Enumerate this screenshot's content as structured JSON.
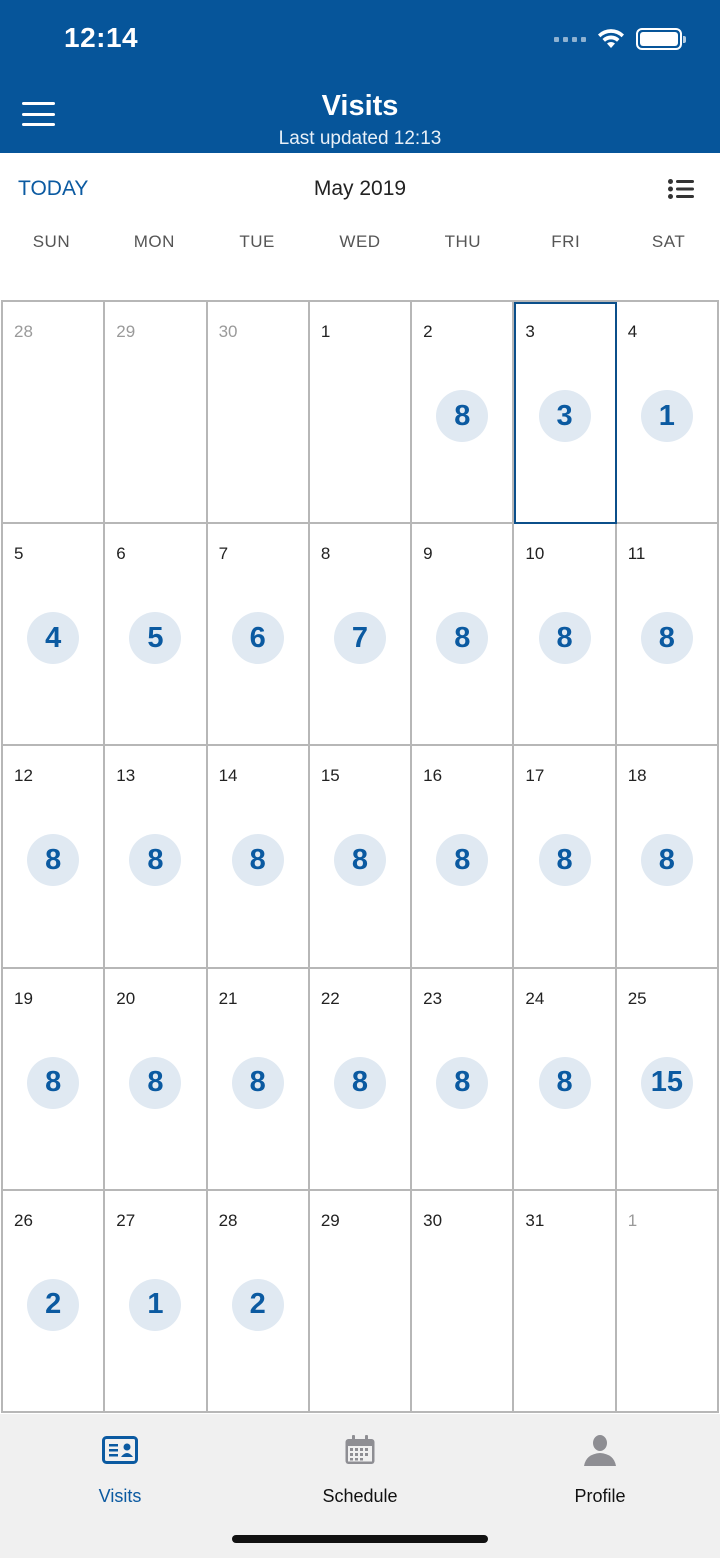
{
  "status_bar": {
    "time": "12:14"
  },
  "header": {
    "title": "Visits",
    "subtitle": "Last updated 12:13"
  },
  "toolbar": {
    "today_label": "TODAY",
    "month": "May 2019"
  },
  "weekdays": [
    "SUN",
    "MON",
    "TUE",
    "WED",
    "THU",
    "FRI",
    "SAT"
  ],
  "calendar": {
    "selected_day": "3",
    "weeks": [
      [
        {
          "day": "28",
          "muted": true,
          "count": ""
        },
        {
          "day": "29",
          "muted": true,
          "count": ""
        },
        {
          "day": "30",
          "muted": true,
          "count": ""
        },
        {
          "day": "1",
          "muted": false,
          "count": ""
        },
        {
          "day": "2",
          "muted": false,
          "count": "8"
        },
        {
          "day": "3",
          "muted": false,
          "count": "3"
        },
        {
          "day": "4",
          "muted": false,
          "count": "1"
        }
      ],
      [
        {
          "day": "5",
          "muted": false,
          "count": "4"
        },
        {
          "day": "6",
          "muted": false,
          "count": "5"
        },
        {
          "day": "7",
          "muted": false,
          "count": "6"
        },
        {
          "day": "8",
          "muted": false,
          "count": "7"
        },
        {
          "day": "9",
          "muted": false,
          "count": "8"
        },
        {
          "day": "10",
          "muted": false,
          "count": "8"
        },
        {
          "day": "11",
          "muted": false,
          "count": "8"
        }
      ],
      [
        {
          "day": "12",
          "muted": false,
          "count": "8"
        },
        {
          "day": "13",
          "muted": false,
          "count": "8"
        },
        {
          "day": "14",
          "muted": false,
          "count": "8"
        },
        {
          "day": "15",
          "muted": false,
          "count": "8"
        },
        {
          "day": "16",
          "muted": false,
          "count": "8"
        },
        {
          "day": "17",
          "muted": false,
          "count": "8"
        },
        {
          "day": "18",
          "muted": false,
          "count": "8"
        }
      ],
      [
        {
          "day": "19",
          "muted": false,
          "count": "8"
        },
        {
          "day": "20",
          "muted": false,
          "count": "8"
        },
        {
          "day": "21",
          "muted": false,
          "count": "8"
        },
        {
          "day": "22",
          "muted": false,
          "count": "8"
        },
        {
          "day": "23",
          "muted": false,
          "count": "8"
        },
        {
          "day": "24",
          "muted": false,
          "count": "8"
        },
        {
          "day": "25",
          "muted": false,
          "count": "15"
        }
      ],
      [
        {
          "day": "26",
          "muted": false,
          "count": "2"
        },
        {
          "day": "27",
          "muted": false,
          "count": "1"
        },
        {
          "day": "28",
          "muted": false,
          "count": "2"
        },
        {
          "day": "29",
          "muted": false,
          "count": ""
        },
        {
          "day": "30",
          "muted": false,
          "count": ""
        },
        {
          "day": "31",
          "muted": false,
          "count": ""
        },
        {
          "day": "1",
          "muted": true,
          "count": ""
        }
      ]
    ]
  },
  "tabs": [
    {
      "label": "Visits",
      "icon": "visits-card-icon",
      "active": true
    },
    {
      "label": "Schedule",
      "icon": "calendar-icon",
      "active": false
    },
    {
      "label": "Profile",
      "icon": "person-icon",
      "active": false
    }
  ],
  "colors": {
    "header_bg": "#06559a",
    "accent": "#0b5aa1",
    "badge_bg": "#e0e9f2",
    "grid_line": "#b7b7b7",
    "tabbar_bg": "#f0f0f0"
  }
}
